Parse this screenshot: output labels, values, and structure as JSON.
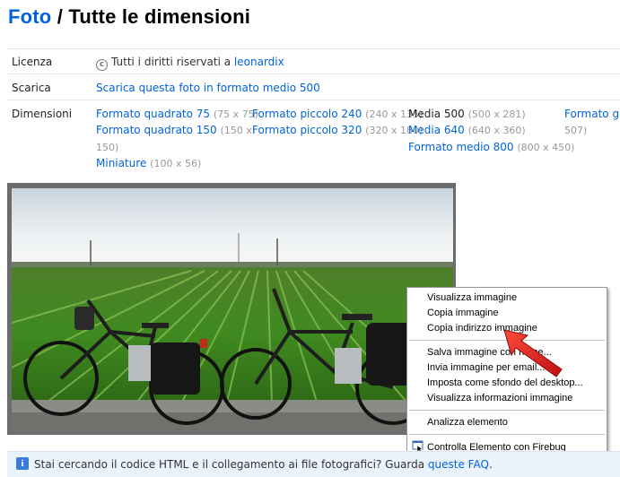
{
  "header": {
    "breadcrumb": "Foto",
    "separator": " / ",
    "title": "Tutte le dimensioni"
  },
  "license": {
    "label": "Licenza",
    "text": "Tutti i diritti riservati a ",
    "author": "leonardix",
    "icon": "copyright-icon"
  },
  "download": {
    "label": "Scarica",
    "link": "Scarica questa foto in formato medio 500"
  },
  "dimensions": {
    "label": "Dimensioni",
    "sizes": [
      {
        "name": "Formato quadrato 75",
        "dims": "(75 x 75)",
        "current": false
      },
      {
        "name": "Formato quadrato 150",
        "dims": "(150 x",
        "dims2": "150)",
        "current": false
      },
      {
        "name": "Miniature",
        "dims": "(100 x 56)",
        "current": false
      },
      {
        "name": "Formato piccolo 240",
        "dims": "(240 x 135)",
        "current": false
      },
      {
        "name": "Formato piccolo 320",
        "dims": "(320 x 180)",
        "current": false
      },
      {
        "name": "Media 500",
        "dims": "(500 x 281)",
        "current": true
      },
      {
        "name": "Media 640",
        "dims": "(640 x 360)",
        "current": false
      },
      {
        "name": "Formato medio 800",
        "dims": "(800 x 450)",
        "current": false
      },
      {
        "name": "Formato gra",
        "dims": "507)",
        "current": false
      }
    ]
  },
  "context_menu": {
    "items": [
      {
        "label": "Visualizza immagine"
      },
      {
        "label": "Copia immagine"
      },
      {
        "label": "Copia indirizzo immagine"
      },
      {
        "label": "Salva immagine con nome..."
      },
      {
        "label": "Invia immagine per email..."
      },
      {
        "label": "Imposta come sfondo del desktop..."
      },
      {
        "label": "Visualizza informazioni immagine"
      },
      {
        "label": "Analizza elemento"
      },
      {
        "label": "Controlla Elemento con Firebug"
      }
    ]
  },
  "info_bar": {
    "text": "Stai cercando il codice HTML e il collegamento ai file fotografici? Guarda ",
    "link": "queste FAQ",
    "end": ".",
    "icon": "info-icon"
  },
  "colors": {
    "link": "#0063dc",
    "info_bg": "#eaf2fb",
    "arrow": "#e8211c"
  }
}
